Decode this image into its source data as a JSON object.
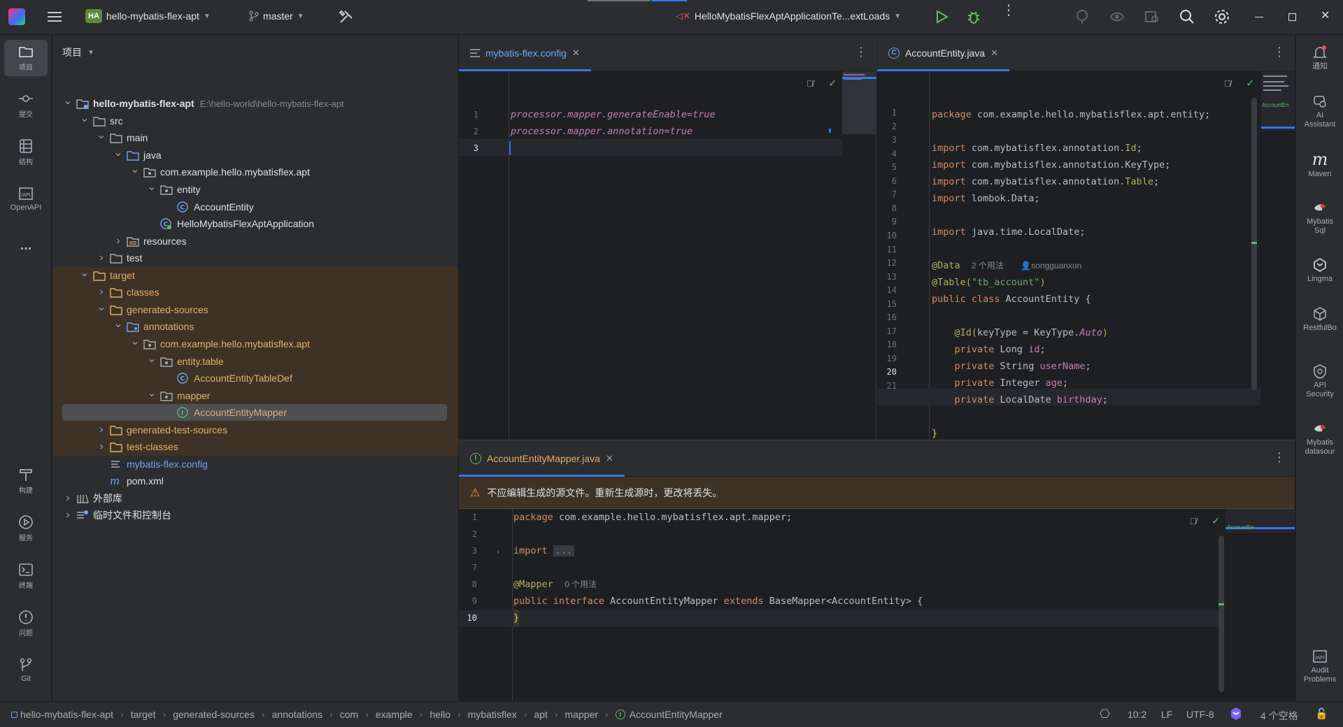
{
  "titlebar": {
    "project_badge": "HA",
    "project_name": "hello-mybatis-flex-apt",
    "branch": "master",
    "run_config": "HelloMybatisFlexAptApplicationTe...extLoads"
  },
  "left_strip": [
    {
      "label": "项目",
      "icon": "folder-icon"
    },
    {
      "label": "提交",
      "icon": "commit-icon"
    },
    {
      "label": "结构",
      "icon": "structure-icon"
    },
    {
      "label": "OpenAPI",
      "icon": "openapi-icon"
    },
    {
      "label": "...",
      "icon": "more-icon"
    },
    {
      "label": "构建",
      "icon": "build-icon"
    },
    {
      "label": "服务",
      "icon": "services-icon"
    },
    {
      "label": "终端",
      "icon": "terminal-icon"
    },
    {
      "label": "问题",
      "icon": "problems-icon"
    },
    {
      "label": "Git",
      "icon": "git-icon"
    }
  ],
  "right_strip": [
    {
      "label": "通知",
      "icon": "bell-icon"
    },
    {
      "label": "AI Assistant",
      "icon": "ai-icon"
    },
    {
      "label": "Maven",
      "icon": "maven-icon"
    },
    {
      "label": "Mybatis Sql",
      "icon": "bird-icon"
    },
    {
      "label": "Lingma",
      "icon": "lingma-icon"
    },
    {
      "label": "RestfulBo",
      "icon": "cube-icon"
    },
    {
      "label": "API Security",
      "icon": "shield-icon"
    },
    {
      "label": "Mybatis datasour",
      "icon": "bird-icon"
    },
    {
      "label": "Audit Problems",
      "icon": "audit-icon"
    }
  ],
  "project_panel": {
    "title": "项目",
    "tree": [
      {
        "label": "hello-mybatis-flex-apt",
        "path": "E:\\hello-world\\hello-mybatis-flex-apt",
        "depth": 0,
        "arrow": "open",
        "icon": "module-folder-icon",
        "style": "bold"
      },
      {
        "label": "src",
        "depth": 1,
        "arrow": "open",
        "icon": "folder-icon"
      },
      {
        "label": "main",
        "depth": 2,
        "arrow": "open",
        "icon": "folder-icon"
      },
      {
        "label": "java",
        "depth": 3,
        "arrow": "open",
        "icon": "source-folder-icon"
      },
      {
        "label": "com.example.hello.mybatisflex.apt",
        "depth": 4,
        "arrow": "open",
        "icon": "package-icon"
      },
      {
        "label": "entity",
        "depth": 5,
        "arrow": "open",
        "icon": "package-icon"
      },
      {
        "label": "AccountEntity",
        "depth": 6,
        "arrow": "none",
        "icon": "class-icon"
      },
      {
        "label": "HelloMybatisFlexAptApplication",
        "depth": 5,
        "arrow": "none",
        "icon": "spring-class-icon"
      },
      {
        "label": "resources",
        "depth": 3,
        "arrow": "closed",
        "icon": "resources-folder-icon"
      },
      {
        "label": "test",
        "depth": 2,
        "arrow": "closed",
        "icon": "folder-icon"
      },
      {
        "label": "target",
        "depth": 1,
        "arrow": "open",
        "icon": "excluded-folder-icon",
        "style": "orange"
      },
      {
        "label": "classes",
        "depth": 2,
        "arrow": "closed",
        "icon": "excluded-folder-icon",
        "style": "orange"
      },
      {
        "label": "generated-sources",
        "depth": 2,
        "arrow": "open",
        "icon": "excluded-folder-icon",
        "style": "orange"
      },
      {
        "label": "annotations",
        "depth": 3,
        "arrow": "open",
        "icon": "generated-folder-icon",
        "style": "orange"
      },
      {
        "label": "com.example.hello.mybatisflex.apt",
        "depth": 4,
        "arrow": "open",
        "icon": "package-icon",
        "style": "orange"
      },
      {
        "label": "entity.table",
        "depth": 5,
        "arrow": "open",
        "icon": "package-icon",
        "style": "orange"
      },
      {
        "label": "AccountEntityTableDef",
        "depth": 6,
        "arrow": "none",
        "icon": "class-icon",
        "style": "orange"
      },
      {
        "label": "mapper",
        "depth": 5,
        "arrow": "open",
        "icon": "package-icon",
        "style": "orange"
      },
      {
        "label": "AccountEntityMapper",
        "depth": 6,
        "arrow": "none",
        "icon": "interface-icon",
        "style": "orange-selected"
      },
      {
        "label": "generated-test-sources",
        "depth": 2,
        "arrow": "closed",
        "icon": "excluded-folder-icon",
        "style": "orange"
      },
      {
        "label": "test-classes",
        "depth": 2,
        "arrow": "closed",
        "icon": "excluded-folder-icon",
        "style": "orange"
      },
      {
        "label": "mybatis-flex.config",
        "depth": 2,
        "arrow": "none",
        "icon": "config-file-icon",
        "style": "blue"
      },
      {
        "label": "pom.xml",
        "depth": 2,
        "arrow": "none",
        "icon": "maven-file-icon"
      },
      {
        "label": "外部库",
        "depth": 0,
        "arrow": "closed",
        "icon": "library-icon"
      },
      {
        "label": "临时文件和控制台",
        "depth": 0,
        "arrow": "closed",
        "icon": "scratch-icon"
      }
    ]
  },
  "editor_config": {
    "tab": "mybatis-flex.config",
    "lines": [
      "processor.mapper.generateEnable=true",
      "processor.mapper.annotation=true",
      ""
    ],
    "line_numbers": [
      "1",
      "2",
      "3"
    ]
  },
  "editor_entity": {
    "tab": "AccountEntity.java",
    "line_numbers": [
      "1",
      "2",
      "3",
      "4",
      "5",
      "6",
      "7",
      "8",
      "9",
      "10",
      "11",
      "12",
      "13",
      "14",
      "15",
      "16",
      "17",
      "18",
      "19",
      "20",
      "21"
    ],
    "code": {
      "l1_kw": "package",
      "l1_rest": " com.example.hello.mybatisflex.apt.entity;",
      "l3": "com.mybatisflex.annotation.",
      "l3_cls": "Id",
      "l4": "com.mybatisflex.annotation.KeyType;",
      "l5": "com.mybatisflex.annotation.",
      "l5_cls": "Table",
      "l6": "lombok.Data;",
      "l8": "java.time.LocalDate;",
      "import_kw": "import",
      "l10_ann": "@Data",
      "l10_hint": "2 个用法",
      "l10_author": "songguanxun",
      "l11_ann": "@Table(",
      "l11_str": "\"tb_account\"",
      "l11_close": ")",
      "l12_kw": "public class",
      "l12_rest": " AccountEntity {",
      "l14_ann": "@Id(",
      "l14_mid": "keyType = KeyType.",
      "l14_val": "Auto",
      "l14_close": ")",
      "private_kw": "private",
      "l15_type": " Long ",
      "l15_fld": "id",
      "l16_type": " String ",
      "l16_fld": "userName",
      "l17_type": " Integer ",
      "l17_fld": "age",
      "l18_type": " LocalDate ",
      "l18_fld": "birthday",
      "l20": "}"
    }
  },
  "editor_mapper": {
    "tab": "AccountEntityMapper.java",
    "warning": "不应编辑生成的源文件。重新生成源时，更改将丢失。",
    "line_numbers": [
      "1",
      "2",
      "3",
      "7",
      "8",
      "9",
      "10"
    ],
    "code": {
      "l1_kw": "package",
      "l1_rest": " com.example.hello.mybatisflex.apt.mapper;",
      "l3_kw": "import",
      "l3_fold": "...",
      "l8_ann": "@Mapper",
      "l8_hint": "0 个用法",
      "l9_kw1": "public interface",
      "l9_name": " AccountEntityMapper ",
      "l9_kw2": "extends",
      "l9_rest": " BaseMapper<AccountEntity> {",
      "l10": "}"
    },
    "minimap_label": "AccountEn"
  },
  "entity_minimap_label": "AccountEn",
  "status": {
    "breadcrumbs": [
      "hello-mybatis-flex-apt",
      "target",
      "generated-sources",
      "annotations",
      "com",
      "example",
      "hello",
      "mybatisflex",
      "apt",
      "mapper",
      "AccountEntityMapper"
    ],
    "position": "10:2",
    "line_ending": "LF",
    "encoding": "UTF-8",
    "indent": "4 个空格"
  },
  "colors": {
    "accent": "#3574f0",
    "orange_folder": "#e3b06b",
    "generated_bg": "#3d3225",
    "keyword": "#cf8e6d",
    "string": "#6aab73",
    "annotation": "#b3ae60",
    "field": "#c77dbb"
  }
}
